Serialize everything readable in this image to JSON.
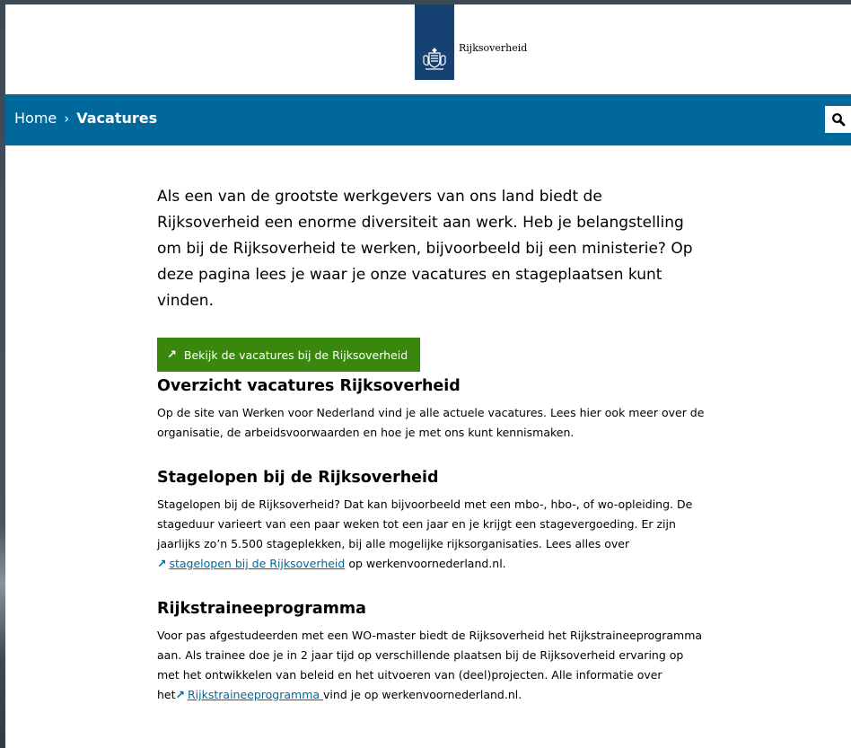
{
  "header": {
    "logo_text": "Rijksoverheid"
  },
  "breadcrumb": {
    "home": "Home",
    "separator": "›",
    "current": "Vacatures"
  },
  "search": {
    "icon": "search-icon"
  },
  "intro": "Als een van de grootste werkgevers van ons land biedt de Rijksoverheid een enorme diversiteit aan werk. Heb je belangstelling om bij de Rijksoverheid te werken, bijvoorbeeld bij een ministerie? Op deze pagina lees je waar je onze vacatures en stageplaatsen kunt vinden.",
  "cta": {
    "label": "Bekijk de vacatures bij de Rijksoverheid",
    "icon": "external-arrow-icon"
  },
  "sections": [
    {
      "title": "Overzicht vacatures Rijksoverheid",
      "body": "Op de site van Werken voor Nederland vind je alle actuele vacatures. Lees hier ook meer over de organisatie, de arbeidsvoorwaarden en hoe je met ons kunt kennismaken."
    },
    {
      "title": "Stagelopen bij de Rijksoverheid",
      "body_before": "Stagelopen bij de Rijksoverheid? Dat kan bijvoorbeeld met een mbo-, hbo-, of wo-opleiding. De stageduur varieert van een paar weken tot een jaar en je krijgt een stagevergoeding. Er zijn jaarlijks zo’n 5.500 stageplekken, bij alle mogelijke rijksorganisaties. Lees alles over ",
      "link": "stagelopen bij de Rijksoverheid",
      "body_after": " op werkenvoornederland.nl."
    },
    {
      "title": "Rijkstraineeprogramma",
      "body_before": "Voor pas afgestudeerden met een WO-master biedt de Rijksoverheid het Rijkstraineeprogramma aan. Als trainee doe je in 2 jaar tijd op verschillende plaatsen bij de Rijksoverheid ervaring op met het ontwikkelen van beleid en het uitvoeren van (deel)projecten. Alle informatie over het",
      "link": "Rijkstraineeprogramma ",
      "body_after": "vind je op werkenvoornederland.nl."
    }
  ],
  "colors": {
    "navbar": "#01689b",
    "logo_ribbon": "#154273",
    "cta": "#39870c",
    "link": "#01689b"
  }
}
